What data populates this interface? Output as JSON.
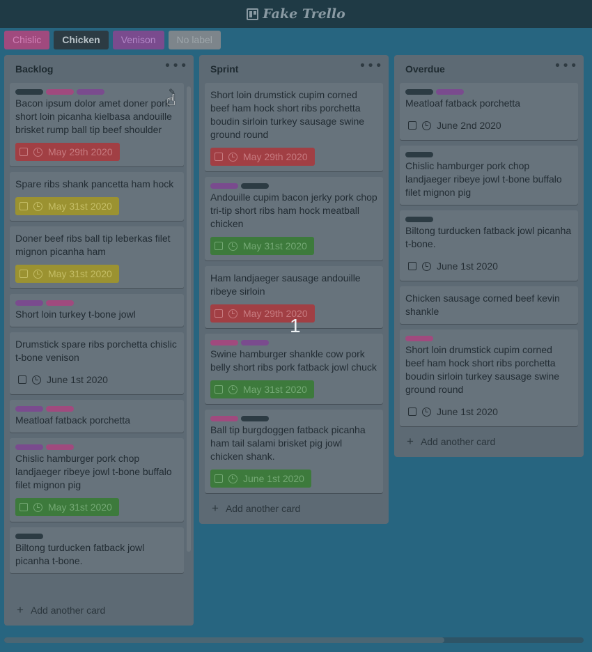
{
  "app": {
    "title": "Fake Trello"
  },
  "colors": {
    "pink": "#a04a7e",
    "dark": "#2c3b43",
    "purple": "#7a4b8e",
    "gray": "#7d858b",
    "red": "#a13f44",
    "yellow": "#9b9231",
    "green": "#3d7a3c"
  },
  "filters": [
    {
      "label": "Chislic",
      "color": "#a04a7e",
      "text_color": "#d382b8"
    },
    {
      "label": "Chicken",
      "color": "#2c3b43",
      "text_color": "#b9c3c8"
    },
    {
      "label": "Venison",
      "color": "#7a4b8e",
      "text_color": "#b387c7"
    },
    {
      "label": "No label",
      "color": "#7d858b",
      "text_color": "#9ea6ab"
    }
  ],
  "lists": [
    {
      "title": "Backlog",
      "add_label": "Add another card",
      "cards": [
        {
          "labels": [
            "dark",
            "pink",
            "purple"
          ],
          "text": "Bacon ipsum dolor amet doner pork short loin picanha kielbasa andouille brisket rump ball tip beef shoulder",
          "due": "May 29th 2020",
          "due_state": "red"
        },
        {
          "labels": [],
          "text": "Spare ribs shank pancetta ham hock",
          "due": "May 31st 2020",
          "due_state": "yellow"
        },
        {
          "labels": [],
          "text": "Doner beef ribs ball tip leberkas filet mignon picanha ham",
          "due": "May 31st 2020",
          "due_state": "yellow"
        },
        {
          "labels": [
            "purple",
            "pink"
          ],
          "text": "Short loin turkey t-bone jowl",
          "due": "",
          "due_state": ""
        },
        {
          "labels": [],
          "text": "Drumstick spare ribs porchetta chislic t-bone venison",
          "due": "June 1st 2020",
          "due_state": "plain"
        },
        {
          "labels": [
            "purple",
            "pink"
          ],
          "text": "Meatloaf fatback porchetta",
          "due": "",
          "due_state": ""
        },
        {
          "labels": [
            "purple",
            "pink"
          ],
          "text": "Chislic hamburger pork chop landjaeger ribeye jowl t-bone buffalo filet mignon pig",
          "due": "May 31st 2020",
          "due_state": "green"
        },
        {
          "labels": [
            "dark"
          ],
          "text": "Biltong turducken fatback jowl picanha t-bone.",
          "due": "",
          "due_state": ""
        }
      ]
    },
    {
      "title": "Sprint",
      "add_label": "Add another card",
      "cards": [
        {
          "labels": [],
          "text": "Short loin drumstick cupim corned beef ham hock short ribs porchetta boudin sirloin turkey sausage swine ground round",
          "due": "May 29th 2020",
          "due_state": "red"
        },
        {
          "labels": [
            "purple",
            "dark"
          ],
          "text": "Andouille cupim bacon jerky pork chop tri-tip short ribs ham hock meatball chicken",
          "due": "May 31st 2020",
          "due_state": "green"
        },
        {
          "labels": [],
          "text": "Ham landjaeger sausage andouille ribeye sirloin",
          "due": "May 29th 2020",
          "due_state": "red"
        },
        {
          "labels": [
            "pink",
            "purple"
          ],
          "text": "Swine hamburger shankle cow pork belly short ribs pork fatback jowl chuck",
          "due": "May 31st 2020",
          "due_state": "green"
        },
        {
          "labels": [
            "pink",
            "dark"
          ],
          "text": "Ball tip burgdoggen fatback picanha ham tail salami brisket pig jowl chicken shank.",
          "due": "June 1st 2020",
          "due_state": "green"
        }
      ]
    },
    {
      "title": "Overdue",
      "add_label": "Add another card",
      "cards": [
        {
          "labels": [
            "dark",
            "purple"
          ],
          "text": "Meatloaf fatback porchetta",
          "due": "June 2nd 2020",
          "due_state": "plain"
        },
        {
          "labels": [
            "dark"
          ],
          "text": "Chislic hamburger pork chop landjaeger ribeye jowl t-bone buffalo filet mignon pig",
          "due": "",
          "due_state": ""
        },
        {
          "labels": [
            "dark"
          ],
          "text": "Biltong turducken fatback jowl picanha t-bone.",
          "due": "June 1st 2020",
          "due_state": "plain"
        },
        {
          "labels": [],
          "text": "Chicken sausage corned beef kevin shankle",
          "due": "",
          "due_state": ""
        },
        {
          "labels": [
            "pink"
          ],
          "text": "Short loin drumstick cupim corned beef ham hock short ribs porchetta boudin sirloin turkey sausage swine ground round",
          "due": "June 1st 2020",
          "due_state": "plain"
        }
      ]
    }
  ],
  "overlay": {
    "number": "1"
  }
}
